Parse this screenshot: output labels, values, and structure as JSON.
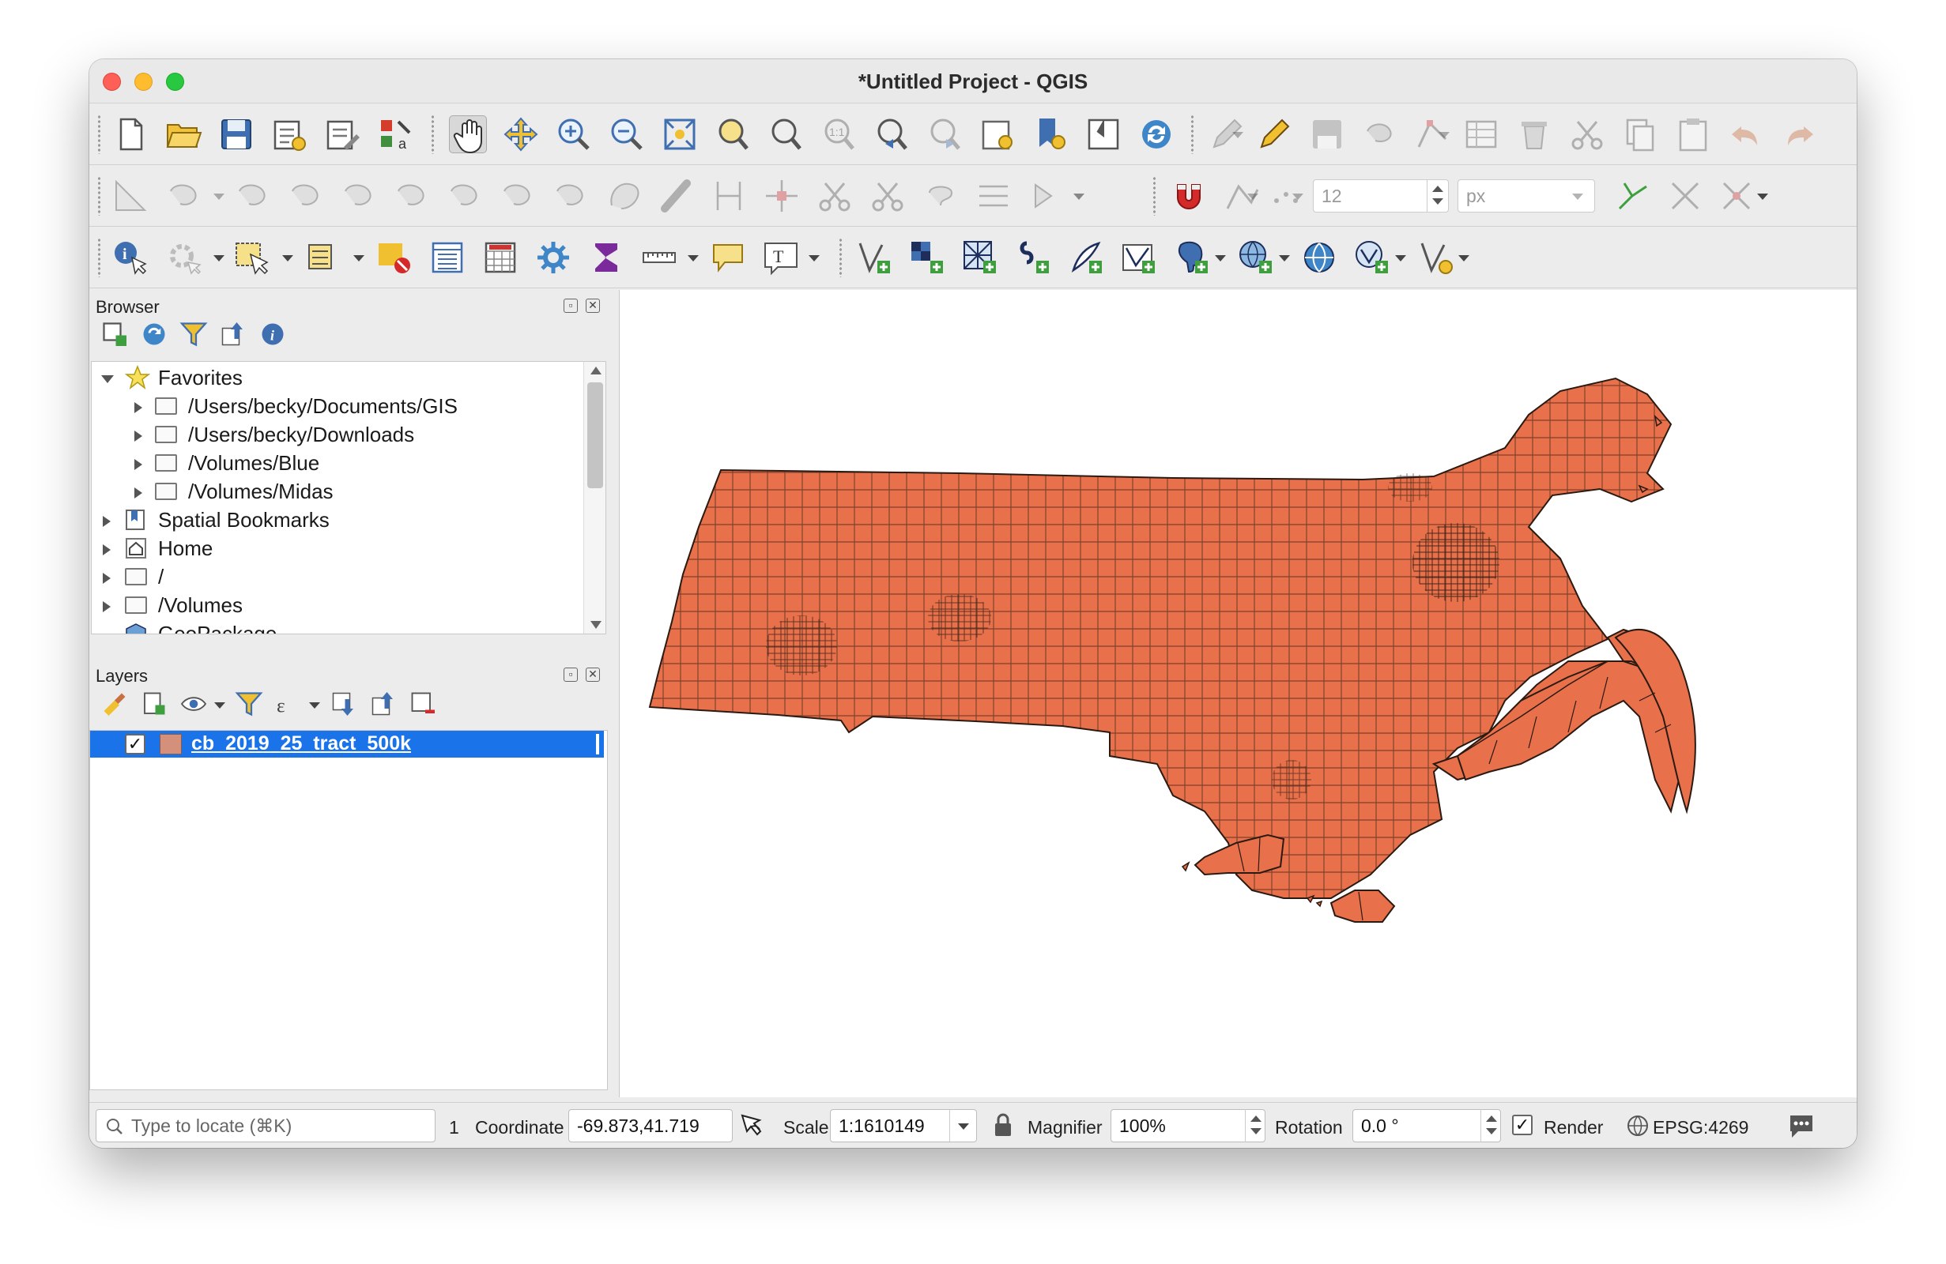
{
  "window": {
    "title": "*Untitled Project - QGIS",
    "traffic_lights": {
      "close": "#fe5f57",
      "minimize": "#febc2e",
      "maximize": "#28c840"
    }
  },
  "toolbar1": {
    "icons": [
      "new-project-icon",
      "open-project-icon",
      "save-project-icon",
      "new-print-layout-icon",
      "layout-manager-icon",
      "style-manager-icon",
      "pan-map-icon",
      "pan-to-selection-icon",
      "zoom-in-icon",
      "zoom-out-icon",
      "zoom-full-icon",
      "zoom-to-selection-icon",
      "zoom-to-layer-icon",
      "zoom-native-icon",
      "zoom-last-icon",
      "zoom-next-icon",
      "new-bookmark-icon",
      "show-bookmarks-icon",
      "new-3d-view-icon",
      "refresh-icon",
      "current-edits-icon",
      "toggle-editing-icon",
      "save-edits-icon",
      "add-feature-icon",
      "vertex-tool-icon",
      "modify-attributes-icon",
      "delete-selected-icon",
      "cut-features-icon",
      "copy-features-icon",
      "paste-features-icon",
      "undo-icon",
      "redo-icon"
    ]
  },
  "toolbar2": {
    "snapping_tolerance": "12",
    "snapping_units": "px",
    "icons": [
      "measure-angle-icon",
      "add-ring-icon",
      "fill-ring-icon",
      "delete-ring-icon",
      "delete-part-icon",
      "reshape-icon",
      "offset-curve-icon",
      "split-features-icon",
      "split-parts-icon",
      "merge-features-icon",
      "merge-attributes-icon",
      "rotate-symbol-icon",
      "snapping-magnet-icon",
      "topological-editing-icon",
      "snap-intersection-icon",
      "trace-icon",
      "avoid-overlap-icon",
      "self-snapping-icon"
    ]
  },
  "toolbar3": {
    "icons": [
      "identify-features-icon",
      "run-action-icon",
      "select-features-icon",
      "select-by-value-icon",
      "deselect-all-icon",
      "attribute-table-icon",
      "field-calculator-icon",
      "processing-toolbox-icon",
      "statistical-summary-icon",
      "measure-line-icon",
      "map-tips-icon",
      "text-annotation-icon",
      "new-geopackage-layer-icon",
      "add-raster-layer-icon",
      "add-mesh-layer-icon",
      "add-delimited-text-icon",
      "add-spatialite-icon",
      "add-vector-layer-icon",
      "add-postgis-layer-icon",
      "add-wms-layer-icon",
      "add-xyz-layer-icon",
      "add-wfs-layer-icon",
      "add-virtual-layer-icon"
    ]
  },
  "browser": {
    "title": "Browser",
    "tree": [
      {
        "label": "Favorites",
        "level": 0,
        "expanded": true,
        "icon": "star-icon"
      },
      {
        "label": "/Users/becky/Documents/GIS",
        "level": 1,
        "expanded": false,
        "icon": "folder-icon"
      },
      {
        "label": "/Users/becky/Downloads",
        "level": 1,
        "expanded": false,
        "icon": "folder-icon"
      },
      {
        "label": "/Volumes/Blue",
        "level": 1,
        "expanded": false,
        "icon": "folder-icon"
      },
      {
        "label": "/Volumes/Midas",
        "level": 1,
        "expanded": false,
        "icon": "folder-icon"
      },
      {
        "label": "Spatial Bookmarks",
        "level": 0,
        "expanded": false,
        "icon": "bookmarks-icon"
      },
      {
        "label": "Home",
        "level": 0,
        "expanded": false,
        "icon": "home-icon"
      },
      {
        "label": "/",
        "level": 0,
        "expanded": false,
        "icon": "folder-icon"
      },
      {
        "label": "/Volumes",
        "level": 0,
        "expanded": false,
        "icon": "folder-icon"
      },
      {
        "label": "GeoPackage",
        "level": 0,
        "expanded": false,
        "icon": "geopackage-icon"
      }
    ]
  },
  "layers": {
    "title": "Layers",
    "items": [
      {
        "name": "cb_2019_25_tract_500k",
        "checked": true,
        "selected": true,
        "swatch": "#d4907a"
      }
    ]
  },
  "map": {
    "fill": "#e8704a",
    "stroke": "#2a1a12"
  },
  "status": {
    "locator_placeholder": "Type to locate (⌘K)",
    "message_count": "1",
    "coordinate_label": "Coordinate",
    "coordinate_value": "-69.873,41.719",
    "scale_label": "Scale",
    "scale_value": "1:1610149",
    "magnifier_label": "Magnifier",
    "magnifier_value": "100%",
    "rotation_label": "Rotation",
    "rotation_value": "0.0 °",
    "render_label": "Render",
    "render_checked": true,
    "crs": "EPSG:4269"
  }
}
